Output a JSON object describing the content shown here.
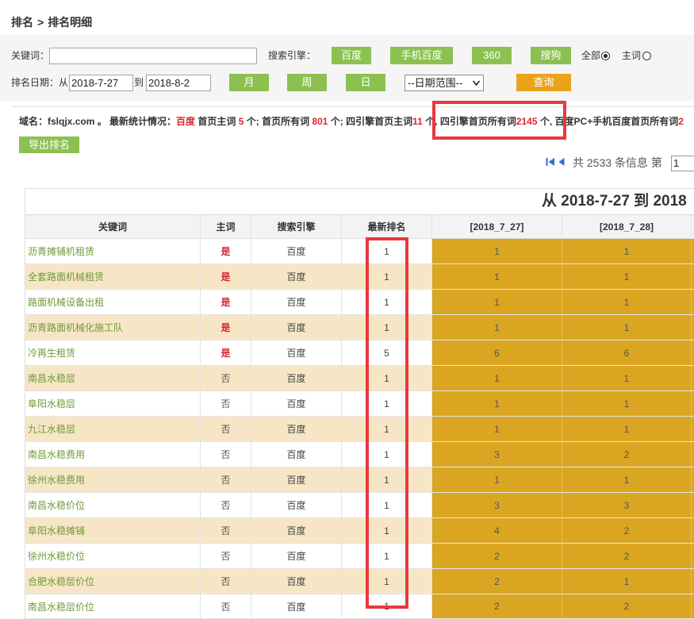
{
  "breadcrumb": {
    "parent": "排名",
    "separator": ">",
    "current": "排名明细"
  },
  "filters": {
    "keyword_label": "关键词：",
    "engine_label": "搜索引擎：",
    "engines": [
      "百度",
      "手机百度",
      "360",
      "搜狗"
    ],
    "scope_options": [
      {
        "label": "全部",
        "checked": true
      },
      {
        "label": "主词",
        "checked": false
      }
    ],
    "date_label": "排名日期：从",
    "date_from": "2018-7-27",
    "date_to_label": "到",
    "date_to": "2018-8-2",
    "period_buttons": [
      "月",
      "周",
      "日"
    ],
    "date_range_select": "--日期范围--",
    "query_button": "查询"
  },
  "stats": {
    "domain_label": "域名：",
    "domain": "fslqjx.com",
    "summary_label": " 。 最新统计情况：",
    "engine": "百度",
    "baidu_home_main_label": " 首页主词 ",
    "baidu_home_main": "5",
    "baidu_home_all_label": " 个; 首页所有词 ",
    "baidu_home_all": "801",
    "four_engine_home_main_label": " 个; 四引擎首页主词",
    "four_engine_home_main": "11",
    "four_engine_home_all_label": " 个, 四引擎首页所有词",
    "four_engine_home_all": "2145",
    "pc_mobile_home_all_label": " 个, 百度PC+手机百度首页所有词",
    "pc_mobile_home_all": "2"
  },
  "export_button": "导出排名",
  "pager": {
    "total_prefix": "共",
    "total": "2533",
    "total_suffix": "条信息",
    "page_label": "第",
    "page": "1"
  },
  "table": {
    "title": "从 2018-7-27 到 2018",
    "columns": [
      "关键词",
      "主词",
      "搜索引擎",
      "最新排名",
      "[2018_7_27]",
      "[2018_7_28]"
    ],
    "rows": [
      {
        "keyword": "沥青摊铺机租赁",
        "main_word": "是",
        "engine": "百度",
        "latest_rank": "1",
        "rank_2018_7_27": "1",
        "rank_2018_7_28": "1"
      },
      {
        "keyword": "全套路面机械租赁",
        "main_word": "是",
        "engine": "百度",
        "latest_rank": "1",
        "rank_2018_7_27": "1",
        "rank_2018_7_28": "1"
      },
      {
        "keyword": "路面机械设备出租",
        "main_word": "是",
        "engine": "百度",
        "latest_rank": "1",
        "rank_2018_7_27": "1",
        "rank_2018_7_28": "1"
      },
      {
        "keyword": "沥青路面机械化施工队",
        "main_word": "是",
        "engine": "百度",
        "latest_rank": "1",
        "rank_2018_7_27": "1",
        "rank_2018_7_28": "1"
      },
      {
        "keyword": "冷再生租赁",
        "main_word": "是",
        "engine": "百度",
        "latest_rank": "5",
        "rank_2018_7_27": "6",
        "rank_2018_7_28": "6"
      },
      {
        "keyword": "南昌水稳层",
        "main_word": "否",
        "engine": "百度",
        "latest_rank": "1",
        "rank_2018_7_27": "1",
        "rank_2018_7_28": "1"
      },
      {
        "keyword": "阜阳水稳层",
        "main_word": "否",
        "engine": "百度",
        "latest_rank": "1",
        "rank_2018_7_27": "1",
        "rank_2018_7_28": "1"
      },
      {
        "keyword": "九江水稳层",
        "main_word": "否",
        "engine": "百度",
        "latest_rank": "1",
        "rank_2018_7_27": "1",
        "rank_2018_7_28": "1"
      },
      {
        "keyword": "南昌水稳费用",
        "main_word": "否",
        "engine": "百度",
        "latest_rank": "1",
        "rank_2018_7_27": "3",
        "rank_2018_7_28": "2"
      },
      {
        "keyword": "徐州水稳费用",
        "main_word": "否",
        "engine": "百度",
        "latest_rank": "1",
        "rank_2018_7_27": "1",
        "rank_2018_7_28": "1"
      },
      {
        "keyword": "南昌水稳价位",
        "main_word": "否",
        "engine": "百度",
        "latest_rank": "1",
        "rank_2018_7_27": "3",
        "rank_2018_7_28": "3"
      },
      {
        "keyword": "阜阳水稳摊铺",
        "main_word": "否",
        "engine": "百度",
        "latest_rank": "1",
        "rank_2018_7_27": "4",
        "rank_2018_7_28": "2"
      },
      {
        "keyword": "徐州水稳价位",
        "main_word": "否",
        "engine": "百度",
        "latest_rank": "1",
        "rank_2018_7_27": "2",
        "rank_2018_7_28": "2"
      },
      {
        "keyword": "合肥水稳层价位",
        "main_word": "否",
        "engine": "百度",
        "latest_rank": "1",
        "rank_2018_7_27": "2",
        "rank_2018_7_28": "1"
      },
      {
        "keyword": "南昌水稳层价位",
        "main_word": "否",
        "engine": "百度",
        "latest_rank": "1",
        "rank_2018_7_27": "2",
        "rank_2018_7_28": "2"
      }
    ]
  },
  "theme": {
    "button_green": "#8cc152",
    "query_orange": "#eaa41c",
    "date_column_gold": "#daa520",
    "row_alt": "#f7e6c6",
    "keyword_green": "#6f9a3a",
    "highlight_red": "#d9282f",
    "annotation_red": "#e8383d",
    "pager_blue": "#2f6fcf"
  }
}
